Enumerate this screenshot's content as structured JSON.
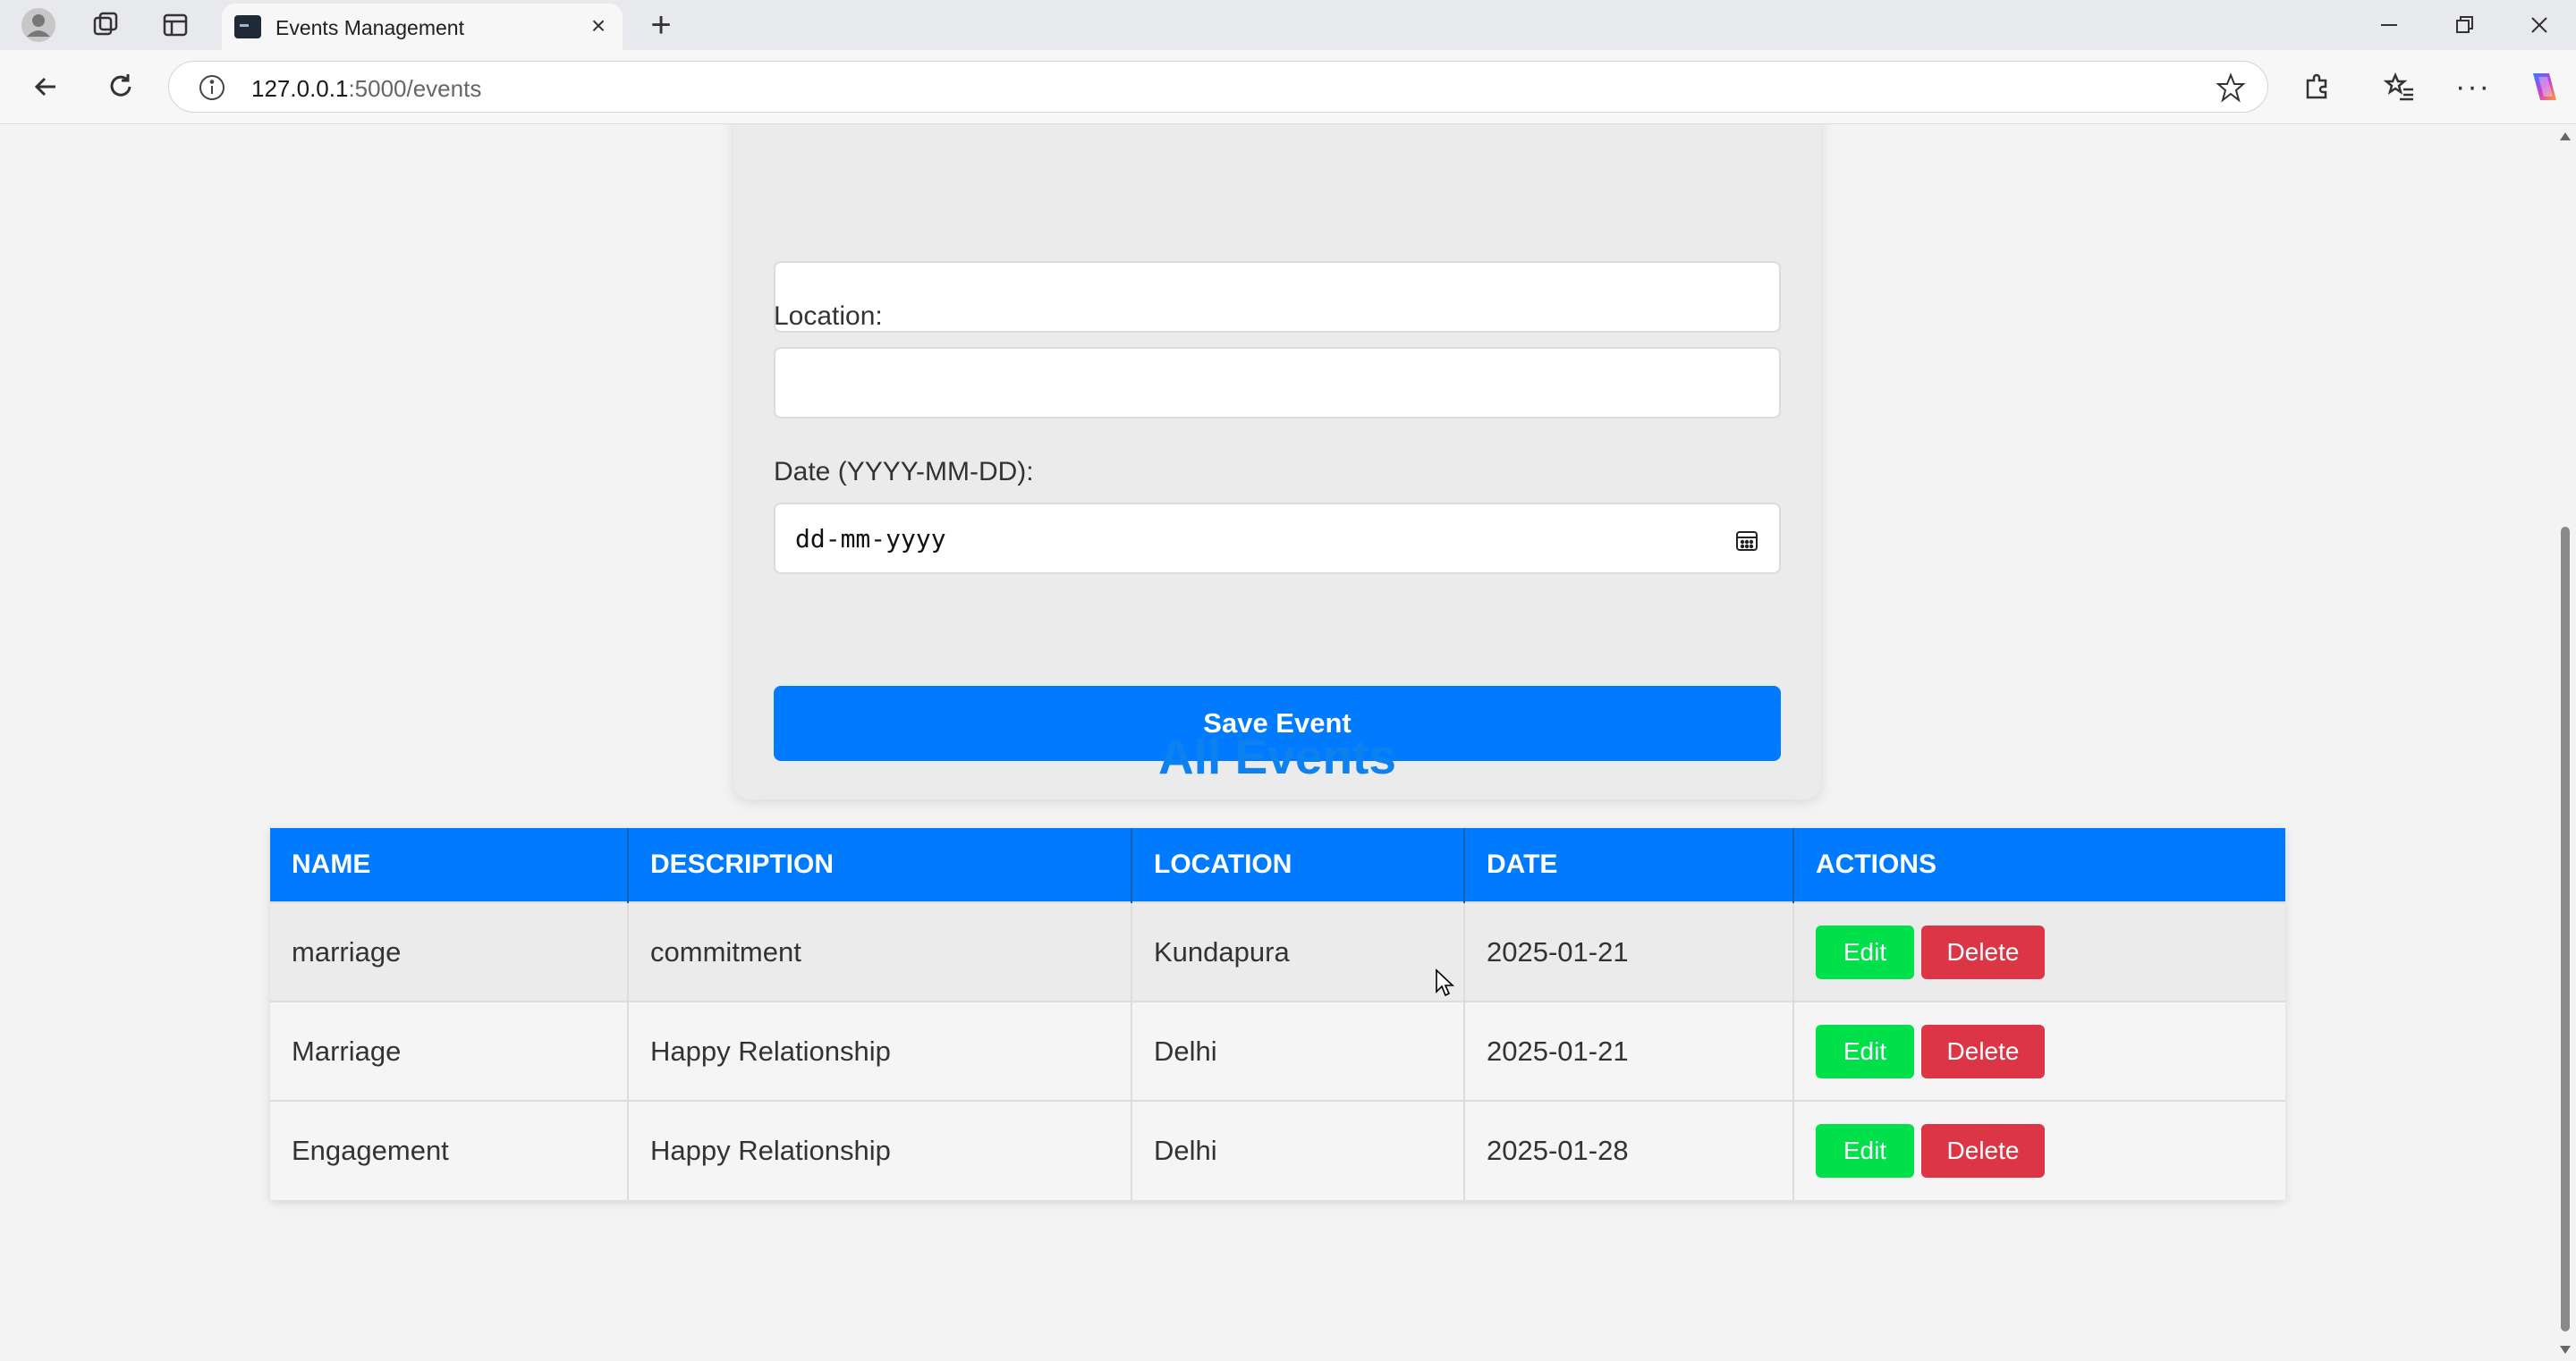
{
  "browser": {
    "tab_title": "Events Management",
    "url_host": "127.0.0.1",
    "url_rest": ":5000/events"
  },
  "form": {
    "location_label": "Location:",
    "date_label": "Date (YYYY-MM-DD):",
    "date_placeholder": "dd-mm-yyyy",
    "save_label": "Save Event"
  },
  "events": {
    "title": "All Events",
    "headers": [
      "NAME",
      "DESCRIPTION",
      "LOCATION",
      "DATE",
      "ACTIONS"
    ],
    "rows": [
      {
        "name": "marriage",
        "description": "commitment",
        "location": "Kundapura",
        "date": "2025-01-21"
      },
      {
        "name": "Marriage",
        "description": "Happy Relationship",
        "location": "Delhi",
        "date": "2025-01-21"
      },
      {
        "name": "Engagement",
        "description": "Happy Relationship",
        "location": "Delhi",
        "date": "2025-01-28"
      }
    ],
    "edit_label": "Edit",
    "delete_label": "Delete"
  },
  "colors": {
    "primary": "#007bff",
    "title": "#0d82ee",
    "edit": "#00e04a",
    "delete": "#dc3545"
  }
}
